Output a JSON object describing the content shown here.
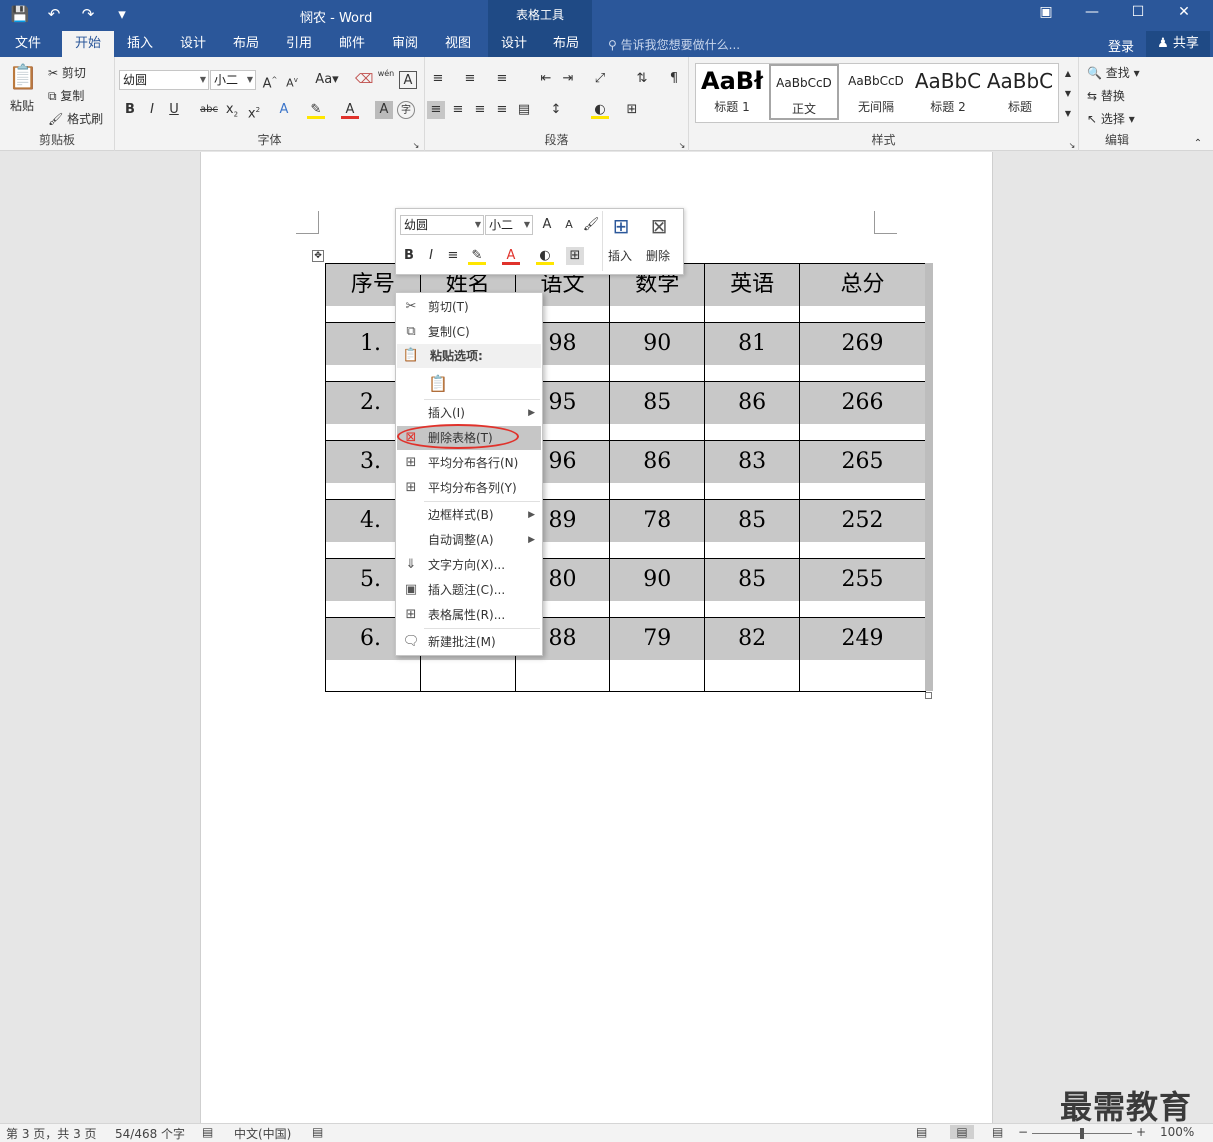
{
  "titlebar": {
    "doc_title": "悯农 - Word",
    "tools_header": "表格工具"
  },
  "tabs": [
    "文件",
    "开始",
    "插入",
    "设计",
    "布局",
    "引用",
    "邮件",
    "审阅",
    "视图",
    "设计",
    "布局"
  ],
  "tellme": "告诉我您想要做什么...",
  "login": "登录",
  "share": "共享",
  "ribbon": {
    "clipboard": {
      "paste": "粘贴",
      "cut": "剪切",
      "copy": "复制",
      "format_painter": "格式刷",
      "label": "剪贴板"
    },
    "font": {
      "name": "幼圆",
      "size": "小二",
      "label": "字体",
      "case_btn": "Aa",
      "phonetic": "wén"
    },
    "paragraph": {
      "label": "段落"
    },
    "styles": {
      "label": "样式",
      "items": [
        {
          "preview": "AaBł",
          "name": "标题 1"
        },
        {
          "preview": "AaBbCcD",
          "name": "正文"
        },
        {
          "preview": "AaBbCcD",
          "name": "无间隔"
        },
        {
          "preview": "AaBbC",
          "name": "标题 2"
        },
        {
          "preview": "AaBbC",
          "name": "标题"
        }
      ]
    },
    "editing": {
      "find": "查找",
      "replace": "替换",
      "select": "选择",
      "label": "编辑"
    }
  },
  "mini_toolbar": {
    "font": "幼圆",
    "size": "小二",
    "insert": "插入",
    "delete": "删除"
  },
  "table": {
    "headers": [
      "序号",
      "姓名",
      "语文",
      "数学",
      "英语",
      "总分"
    ],
    "rows": [
      [
        "1.",
        "",
        "98",
        "90",
        "81",
        "269"
      ],
      [
        "2.",
        "",
        "95",
        "85",
        "86",
        "266"
      ],
      [
        "3.",
        "",
        "96",
        "86",
        "83",
        "265"
      ],
      [
        "4.",
        "",
        "89",
        "78",
        "85",
        "252"
      ],
      [
        "5.",
        "",
        "80",
        "90",
        "85",
        "255"
      ],
      [
        "6.",
        "",
        "88",
        "79",
        "82",
        "249"
      ]
    ]
  },
  "context_menu": {
    "cut": "剪切(T)",
    "copy": "复制(C)",
    "paste_options": "粘贴选项:",
    "insert": "插入(I)",
    "delete_table": "删除表格(T)",
    "distribute_rows": "平均分布各行(N)",
    "distribute_cols": "平均分布各列(Y)",
    "border_styles": "边框样式(B)",
    "autofit": "自动调整(A)",
    "text_direction": "文字方向(X)...",
    "insert_caption": "插入题注(C)...",
    "table_properties": "表格属性(R)...",
    "new_comment": "新建批注(M)"
  },
  "status": {
    "page": "第 3 页，共 3 页",
    "words": "54/468 个字",
    "language": "中文(中国)",
    "zoom": "100%"
  },
  "watermark": "最需教育"
}
